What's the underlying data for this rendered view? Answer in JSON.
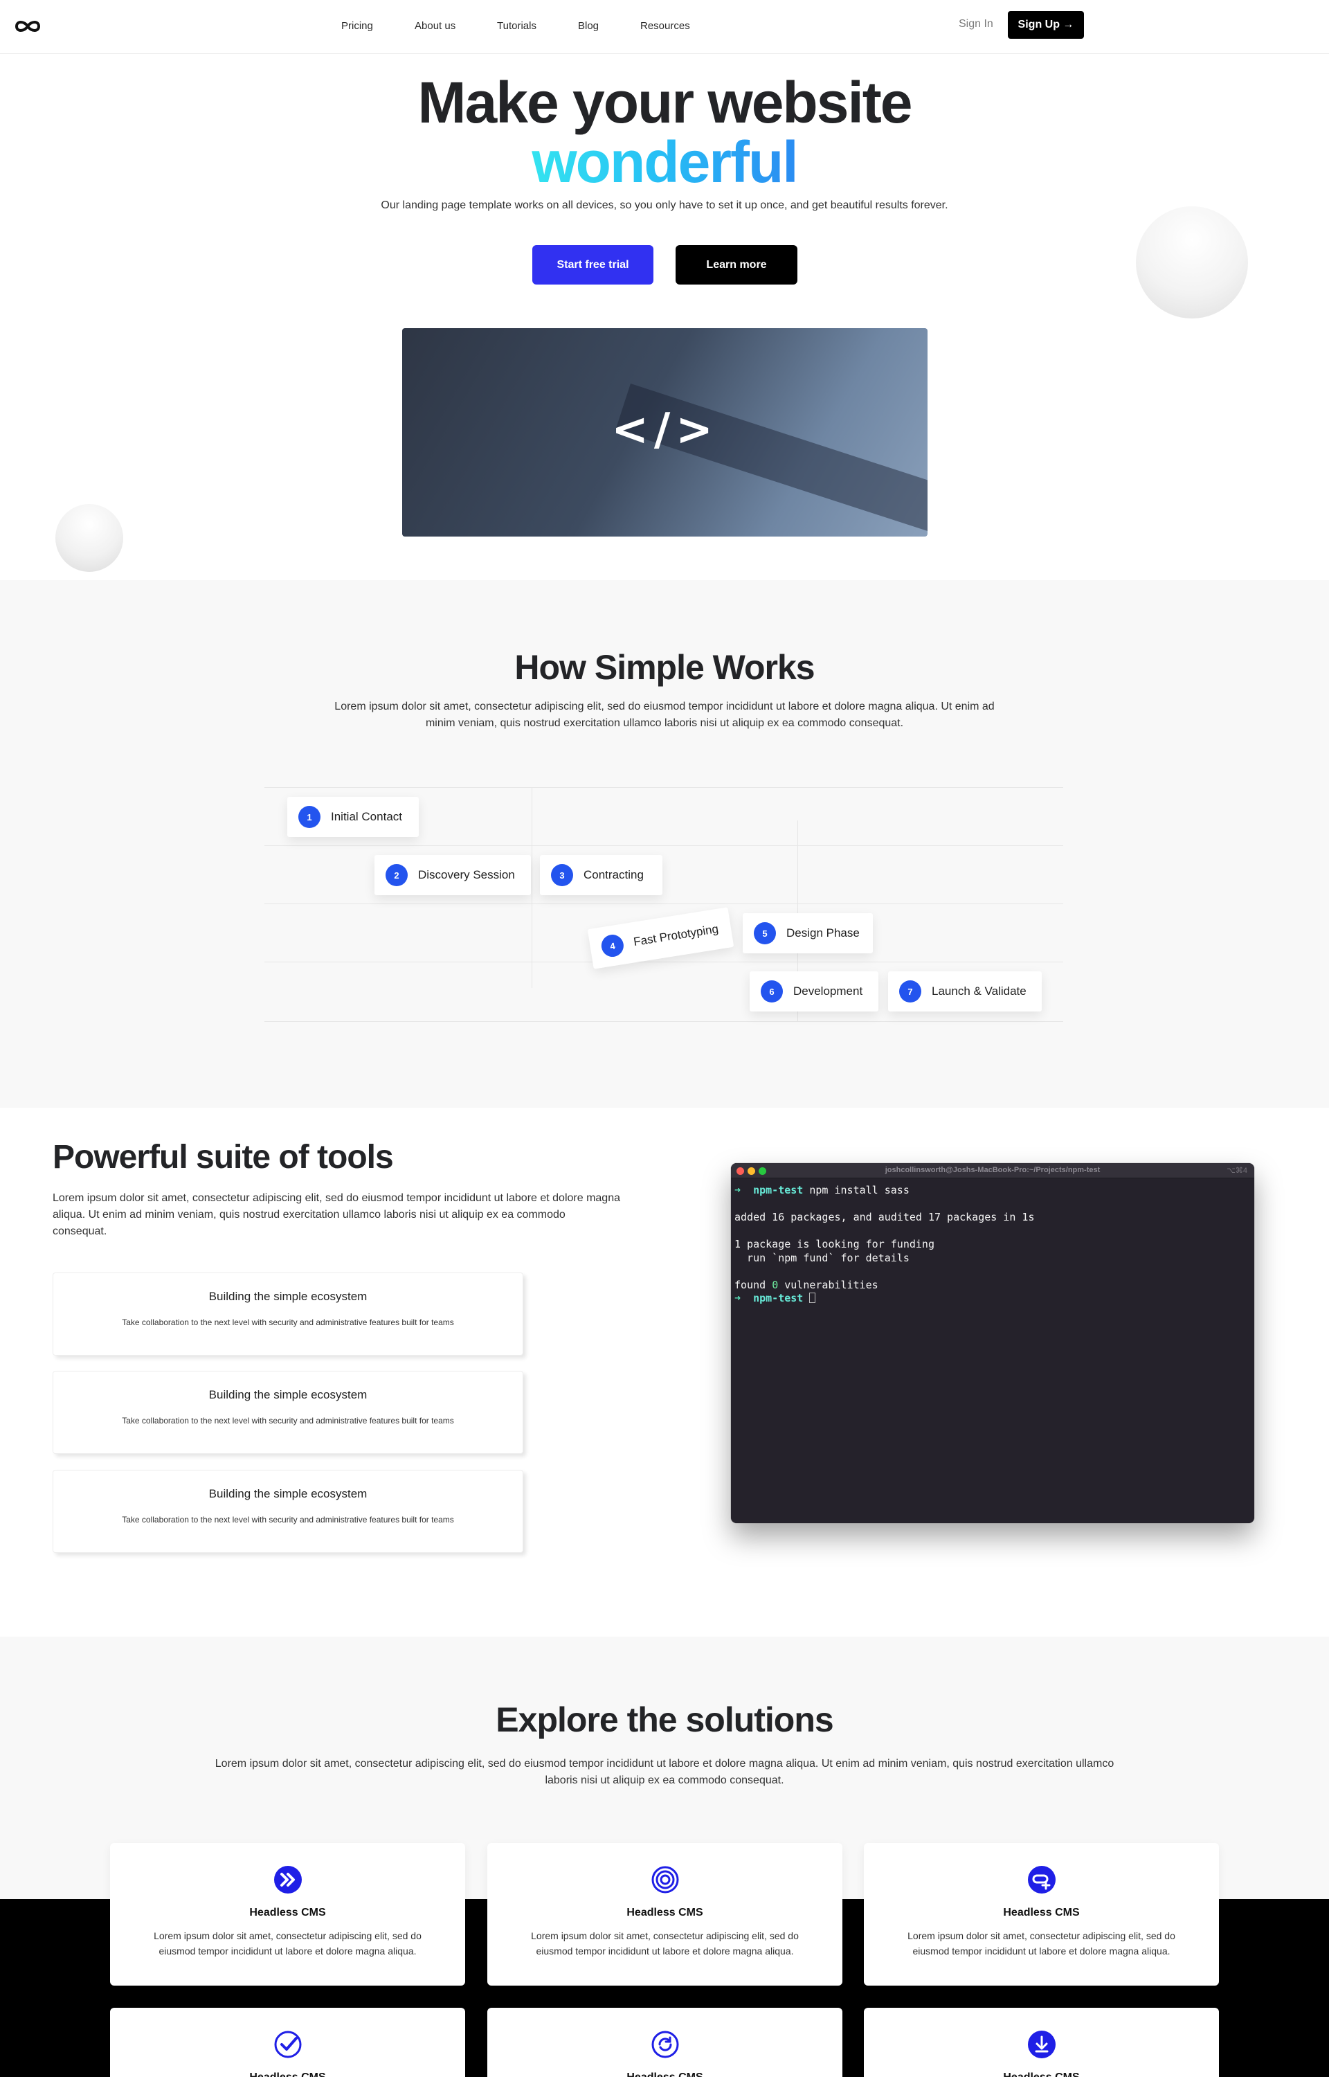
{
  "nav": {
    "logo_icon": "infinity-icon",
    "links": [
      {
        "label": "Pricing"
      },
      {
        "label": "About us"
      },
      {
        "label": "Tutorials"
      },
      {
        "label": "Blog"
      },
      {
        "label": "Resources"
      }
    ],
    "sign_in": "Sign In",
    "sign_up": "Sign Up →"
  },
  "hero": {
    "title": "Make your website",
    "accent": "wonderful",
    "subtitle": "Our landing page template works on all devices, so you only have to set it up once, and get beautiful results forever.",
    "primary_cta": "Start free trial",
    "secondary_cta": "Learn more",
    "media_code": "</>",
    "accent_colors": [
      "#34e3f0",
      "#2a8cf2"
    ],
    "primary_color": "#3131f1"
  },
  "how": {
    "title": "How Simple Works",
    "description": "Lorem ipsum dolor sit amet, consectetur adipiscing elit, sed do eiusmod tempor incididunt ut labore et dolore magna aliqua. Ut enim ad minim veniam, quis nostrud exercitation ullamco laboris nisi ut aliquip ex ea commodo consequat.",
    "steps": [
      {
        "num": "1",
        "label": "Initial Contact"
      },
      {
        "num": "2",
        "label": "Discovery Session"
      },
      {
        "num": "3",
        "label": "Contracting"
      },
      {
        "num": "4",
        "label": "Fast Prototyping"
      },
      {
        "num": "5",
        "label": "Design Phase"
      },
      {
        "num": "6",
        "label": "Development"
      },
      {
        "num": "7",
        "label": "Launch & Validate"
      }
    ],
    "step_color": "#2354ee"
  },
  "tools": {
    "title": "Powerful suite of tools",
    "description": "Lorem ipsum dolor sit amet, consectetur adipiscing elit, sed do eiusmod tempor incididunt ut labore et dolore magna aliqua. Ut enim ad minim veniam, quis nostrud exercitation ullamco laboris nisi ut aliquip ex ea commodo consequat.",
    "cards": [
      {
        "title": "Building the simple ecosystem",
        "text": "Take collaboration to the next level with security and administrative features built for teams"
      },
      {
        "title": "Building the simple ecosystem",
        "text": "Take collaboration to the next level with security and administrative features built for teams"
      },
      {
        "title": "Building the simple ecosystem",
        "text": "Take collaboration to the next level with security and administrative features built for teams"
      }
    ],
    "terminal": {
      "title": "joshcollinsworth@Joshs-MacBook-Pro:~/Projects/npm-test",
      "shortcut": "⌥⌘4",
      "prompt_symbol": "➜",
      "dir": "npm-test",
      "command": "npm install sass",
      "line_added": "added 16 packages, and audited 17 packages in 1s",
      "line_funding": "1 package is looking for funding",
      "line_fund_hint": "  run `npm fund` for details",
      "found_prefix": "found ",
      "found_count": "0",
      "found_suffix": " vulnerabilities"
    }
  },
  "solutions": {
    "title": "Explore the solutions",
    "description": "Lorem ipsum dolor sit amet, consectetur adipiscing elit, sed do eiusmod tempor incididunt ut labore et dolore magna aliqua. Ut enim ad minim veniam, quis nostrud exercitation ullamco laboris nisi ut aliquip ex ea commodo consequat.",
    "cards": [
      {
        "icon": "fast-forward-icon",
        "title": "Headless CMS",
        "text": "Lorem ipsum dolor sit amet, consectetur adipiscing elit, sed do eiusmod tempor incididunt ut labore et dolore magna aliqua."
      },
      {
        "icon": "target-icon",
        "title": "Headless CMS",
        "text": "Lorem ipsum dolor sit amet, consectetur adipiscing elit, sed do eiusmod tempor incididunt ut labore et dolore magna aliqua."
      },
      {
        "icon": "link-plus-icon",
        "title": "Headless CMS",
        "text": "Lorem ipsum dolor sit amet, consectetur adipiscing elit, sed do eiusmod tempor incididunt ut labore et dolore magna aliqua."
      },
      {
        "icon": "check-circle-icon",
        "title": "Headless CMS"
      },
      {
        "icon": "refresh-icon",
        "title": "Headless CMS"
      },
      {
        "icon": "download-icon",
        "title": "Headless CMS"
      }
    ],
    "icon_color": "#1f1fe6"
  }
}
